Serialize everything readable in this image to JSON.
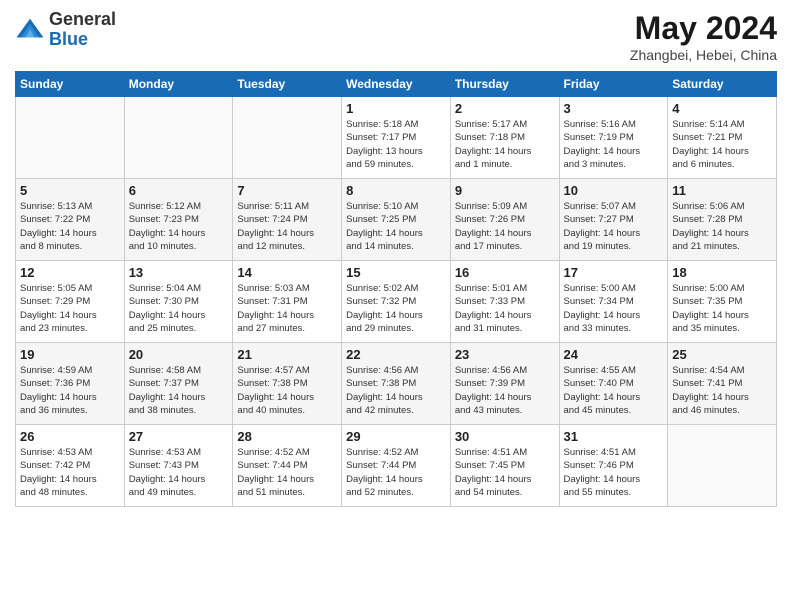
{
  "header": {
    "logo_general": "General",
    "logo_blue": "Blue",
    "title": "May 2024",
    "subtitle": "Zhangbei, Hebei, China"
  },
  "weekdays": [
    "Sunday",
    "Monday",
    "Tuesday",
    "Wednesday",
    "Thursday",
    "Friday",
    "Saturday"
  ],
  "weeks": [
    [
      {
        "day": "",
        "info": ""
      },
      {
        "day": "",
        "info": ""
      },
      {
        "day": "",
        "info": ""
      },
      {
        "day": "1",
        "info": "Sunrise: 5:18 AM\nSunset: 7:17 PM\nDaylight: 13 hours\nand 59 minutes."
      },
      {
        "day": "2",
        "info": "Sunrise: 5:17 AM\nSunset: 7:18 PM\nDaylight: 14 hours\nand 1 minute."
      },
      {
        "day": "3",
        "info": "Sunrise: 5:16 AM\nSunset: 7:19 PM\nDaylight: 14 hours\nand 3 minutes."
      },
      {
        "day": "4",
        "info": "Sunrise: 5:14 AM\nSunset: 7:21 PM\nDaylight: 14 hours\nand 6 minutes."
      }
    ],
    [
      {
        "day": "5",
        "info": "Sunrise: 5:13 AM\nSunset: 7:22 PM\nDaylight: 14 hours\nand 8 minutes."
      },
      {
        "day": "6",
        "info": "Sunrise: 5:12 AM\nSunset: 7:23 PM\nDaylight: 14 hours\nand 10 minutes."
      },
      {
        "day": "7",
        "info": "Sunrise: 5:11 AM\nSunset: 7:24 PM\nDaylight: 14 hours\nand 12 minutes."
      },
      {
        "day": "8",
        "info": "Sunrise: 5:10 AM\nSunset: 7:25 PM\nDaylight: 14 hours\nand 14 minutes."
      },
      {
        "day": "9",
        "info": "Sunrise: 5:09 AM\nSunset: 7:26 PM\nDaylight: 14 hours\nand 17 minutes."
      },
      {
        "day": "10",
        "info": "Sunrise: 5:07 AM\nSunset: 7:27 PM\nDaylight: 14 hours\nand 19 minutes."
      },
      {
        "day": "11",
        "info": "Sunrise: 5:06 AM\nSunset: 7:28 PM\nDaylight: 14 hours\nand 21 minutes."
      }
    ],
    [
      {
        "day": "12",
        "info": "Sunrise: 5:05 AM\nSunset: 7:29 PM\nDaylight: 14 hours\nand 23 minutes."
      },
      {
        "day": "13",
        "info": "Sunrise: 5:04 AM\nSunset: 7:30 PM\nDaylight: 14 hours\nand 25 minutes."
      },
      {
        "day": "14",
        "info": "Sunrise: 5:03 AM\nSunset: 7:31 PM\nDaylight: 14 hours\nand 27 minutes."
      },
      {
        "day": "15",
        "info": "Sunrise: 5:02 AM\nSunset: 7:32 PM\nDaylight: 14 hours\nand 29 minutes."
      },
      {
        "day": "16",
        "info": "Sunrise: 5:01 AM\nSunset: 7:33 PM\nDaylight: 14 hours\nand 31 minutes."
      },
      {
        "day": "17",
        "info": "Sunrise: 5:00 AM\nSunset: 7:34 PM\nDaylight: 14 hours\nand 33 minutes."
      },
      {
        "day": "18",
        "info": "Sunrise: 5:00 AM\nSunset: 7:35 PM\nDaylight: 14 hours\nand 35 minutes."
      }
    ],
    [
      {
        "day": "19",
        "info": "Sunrise: 4:59 AM\nSunset: 7:36 PM\nDaylight: 14 hours\nand 36 minutes."
      },
      {
        "day": "20",
        "info": "Sunrise: 4:58 AM\nSunset: 7:37 PM\nDaylight: 14 hours\nand 38 minutes."
      },
      {
        "day": "21",
        "info": "Sunrise: 4:57 AM\nSunset: 7:38 PM\nDaylight: 14 hours\nand 40 minutes."
      },
      {
        "day": "22",
        "info": "Sunrise: 4:56 AM\nSunset: 7:38 PM\nDaylight: 14 hours\nand 42 minutes."
      },
      {
        "day": "23",
        "info": "Sunrise: 4:56 AM\nSunset: 7:39 PM\nDaylight: 14 hours\nand 43 minutes."
      },
      {
        "day": "24",
        "info": "Sunrise: 4:55 AM\nSunset: 7:40 PM\nDaylight: 14 hours\nand 45 minutes."
      },
      {
        "day": "25",
        "info": "Sunrise: 4:54 AM\nSunset: 7:41 PM\nDaylight: 14 hours\nand 46 minutes."
      }
    ],
    [
      {
        "day": "26",
        "info": "Sunrise: 4:53 AM\nSunset: 7:42 PM\nDaylight: 14 hours\nand 48 minutes."
      },
      {
        "day": "27",
        "info": "Sunrise: 4:53 AM\nSunset: 7:43 PM\nDaylight: 14 hours\nand 49 minutes."
      },
      {
        "day": "28",
        "info": "Sunrise: 4:52 AM\nSunset: 7:44 PM\nDaylight: 14 hours\nand 51 minutes."
      },
      {
        "day": "29",
        "info": "Sunrise: 4:52 AM\nSunset: 7:44 PM\nDaylight: 14 hours\nand 52 minutes."
      },
      {
        "day": "30",
        "info": "Sunrise: 4:51 AM\nSunset: 7:45 PM\nDaylight: 14 hours\nand 54 minutes."
      },
      {
        "day": "31",
        "info": "Sunrise: 4:51 AM\nSunset: 7:46 PM\nDaylight: 14 hours\nand 55 minutes."
      },
      {
        "day": "",
        "info": ""
      }
    ]
  ]
}
